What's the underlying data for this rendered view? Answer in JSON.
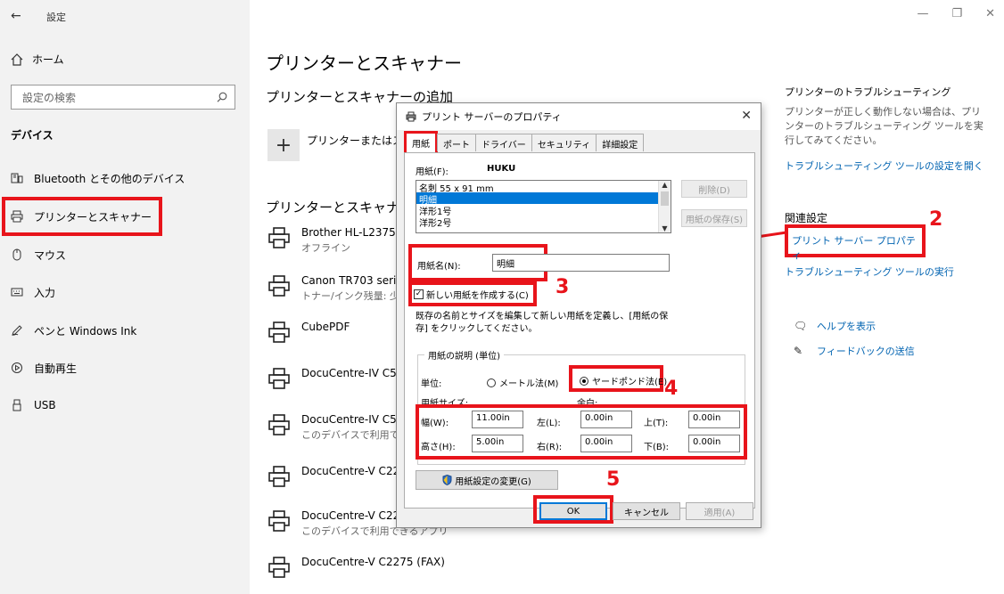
{
  "window": {
    "title": "設定",
    "back_icon": "←",
    "controls": [
      "—",
      "❐",
      "✕"
    ]
  },
  "sidebar": {
    "home": "ホーム",
    "search_placeholder": "設定の検索",
    "section": "デバイス",
    "items": [
      {
        "label": "Bluetooth とその他のデバイス",
        "icon": "bluetooth-devices-icon"
      },
      {
        "label": "プリンターとスキャナー",
        "icon": "printer-icon"
      },
      {
        "label": "マウス",
        "icon": "mouse-icon"
      },
      {
        "label": "入力",
        "icon": "keyboard-icon"
      },
      {
        "label": "ペンと Windows Ink",
        "icon": "pen-icon"
      },
      {
        "label": "自動再生",
        "icon": "autoplay-icon"
      },
      {
        "label": "USB",
        "icon": "usb-icon"
      }
    ]
  },
  "main": {
    "title": "プリンターとスキャナー",
    "add_section": "プリンターとスキャナーの追加",
    "add_label": "プリンターまたはスキ",
    "list_section": "プリンターとスキャナー",
    "printers": [
      {
        "name": "Brother HL-L2375",
        "status": "オフライン"
      },
      {
        "name": "Canon TR703 seri",
        "status": "トナー/インク残量: 少"
      },
      {
        "name": "CubePDF",
        "status": ""
      },
      {
        "name": "DocuCentre-IV C5",
        "status": ""
      },
      {
        "name": "DocuCentre-IV C5",
        "status": "このデバイスで利用て"
      },
      {
        "name": "DocuCentre-V C22",
        "status": ""
      },
      {
        "name": "DocuCentre-V C22",
        "status": "このデバイスで利用できるアプリ"
      },
      {
        "name": "DocuCentre-V C2275 (FAX)",
        "status": ""
      }
    ]
  },
  "right": {
    "troubleshoot_title": "プリンターのトラブルシューティング",
    "troubleshoot_desc": "プリンターが正しく動作しない場合は、プリンターのトラブルシューティング ツールを実行してみてください。",
    "troubleshoot_link": "トラブルシューティング ツールの設定を開く",
    "related_title": "関連設定",
    "print_server_link": "プリント サーバー プロパティ",
    "run_troubleshoot_link": "トラブルシューティング ツールの実行",
    "help_link": "ヘルプを表示",
    "feedback_link": "フィードバックの送信"
  },
  "dialog": {
    "title": "プリント サーバーのプロパティ",
    "tabs": [
      "用紙",
      "ポート",
      "ドライバー",
      "セキュリティ",
      "詳細設定"
    ],
    "paper_label": "用紙(F):",
    "paper_current": "HUKU",
    "paper_list": [
      "名刺 55 x 91 mm",
      "明細",
      "洋形1号",
      "洋形2号"
    ],
    "selected_index": 1,
    "delete_button": "削除(D)",
    "save_button": "用紙の保存(S)",
    "paper_name_label": "用紙名(N):",
    "paper_name_value": "明細",
    "create_new_label": "新しい用紙を作成する(C)",
    "create_new_checked": true,
    "help_text": "既存の名前とサイズを編集して新しい用紙を定義し、[用紙の保存] をクリックしてください。",
    "group_label": "用紙の説明 (単位)",
    "unit_label": "単位:",
    "metric_label": "メートル法(M)",
    "imperial_label": "ヤードポンド法(E)",
    "unit_selected": "imperial",
    "size_label": "用紙サイズ:",
    "margin_label": "余白:",
    "width_label": "幅(W):",
    "width_value": "11.00in",
    "height_label": "高さ(H):",
    "height_value": "5.00in",
    "left_label": "左(L):",
    "left_value": "0.00in",
    "right_label": "右(R):",
    "right_value": "0.00in",
    "top_label": "上(T):",
    "top_value": "0.00in",
    "bottom_label": "下(B):",
    "bottom_value": "0.00in",
    "change_settings_button": "用紙設定の変更(G)",
    "ok_button": "OK",
    "cancel_button": "キャンセル",
    "apply_button": "適用(A)"
  },
  "annotations": [
    "2",
    "3",
    "4",
    "5"
  ],
  "colors": {
    "highlight": "#e8141b",
    "link": "#0063b1",
    "selection": "#0078d7"
  }
}
